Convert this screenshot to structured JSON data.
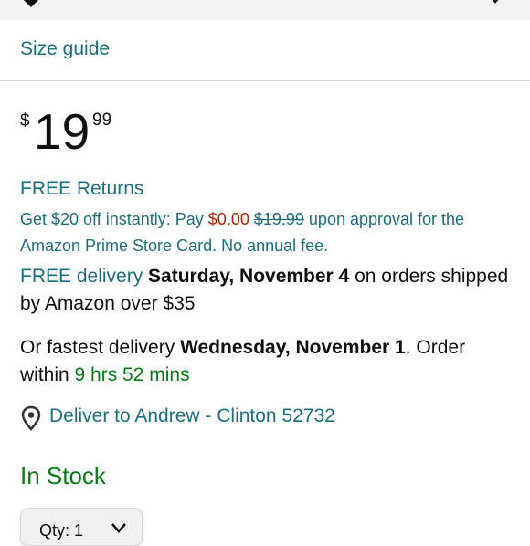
{
  "size_guide": {
    "label": "Size guide"
  },
  "price": {
    "symbol": "$",
    "whole": "19",
    "fraction": "99"
  },
  "returns": {
    "label": "FREE Returns"
  },
  "promo": {
    "prefix": "Get $20 off instantly: Pay ",
    "pay_amount": "$0.00",
    "original_amount": "$19.99",
    "suffix": " upon approval for the Amazon Prime Store Card. No annual fee."
  },
  "delivery": {
    "free_label": "FREE delivery",
    "date": "Saturday, November 4",
    "condition": " on orders shipped by Amazon over $35"
  },
  "fastest": {
    "prefix": "Or fastest delivery ",
    "date": "Wednesday, November 1",
    "middle": ". Order within ",
    "time_left": "9 hrs 52 mins"
  },
  "deliver_to": {
    "label": "Deliver to Andrew - Clinton 52732",
    "icon": "location-pin-icon"
  },
  "stock": {
    "status": "In Stock"
  },
  "quantity": {
    "label": "Qty: 1",
    "icon": "chevron-down-icon"
  },
  "colors": {
    "link": "#1d6f80",
    "price_red": "#b12704",
    "stock_green": "#067d17"
  }
}
